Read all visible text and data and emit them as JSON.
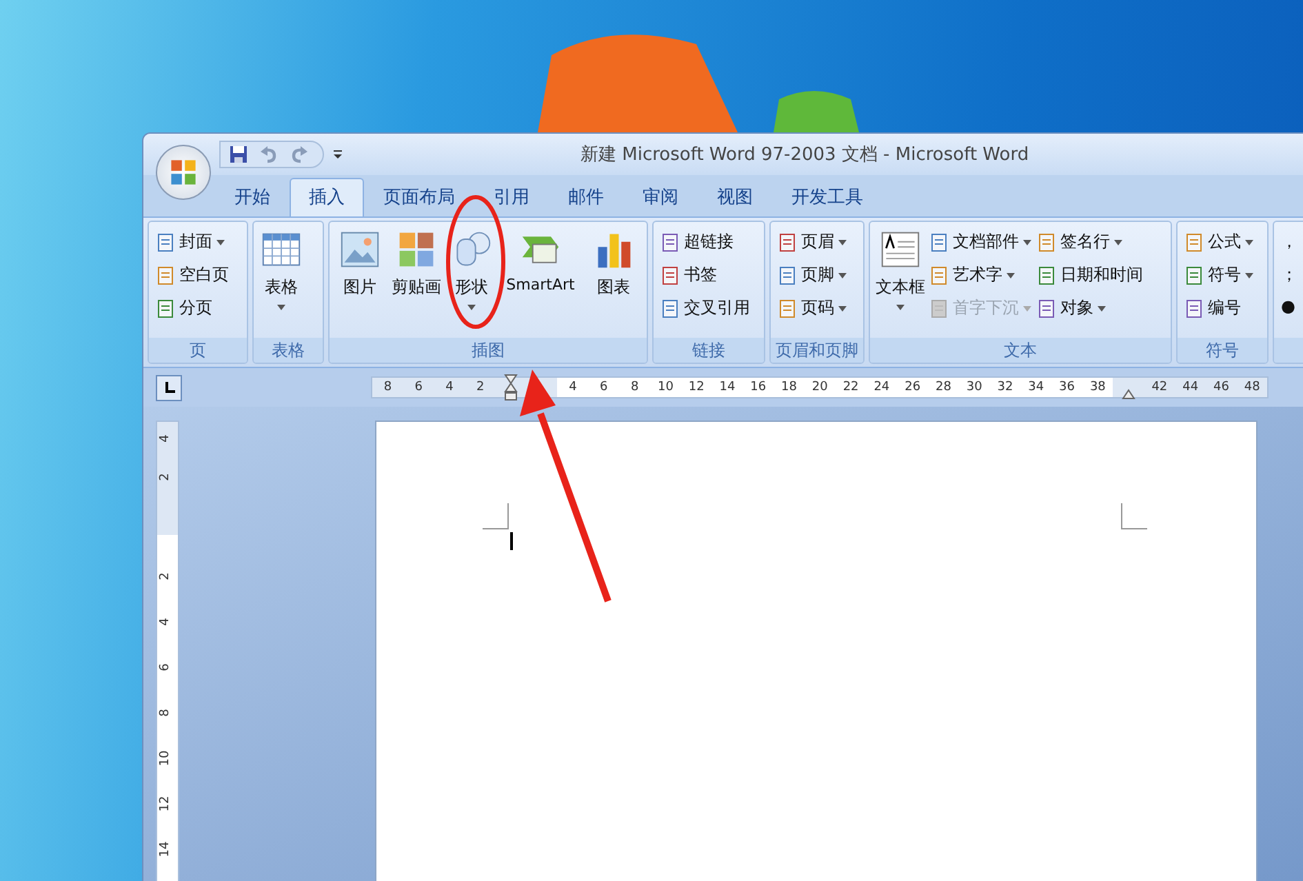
{
  "window": {
    "title": "新建 Microsoft Word 97-2003 文档 - Microsoft Word"
  },
  "tabs": [
    {
      "label": "开始",
      "selected": false
    },
    {
      "label": "插入",
      "selected": true
    },
    {
      "label": "页面布局",
      "selected": false
    },
    {
      "label": "引用",
      "selected": false
    },
    {
      "label": "邮件",
      "selected": false
    },
    {
      "label": "审阅",
      "selected": false
    },
    {
      "label": "视图",
      "selected": false
    },
    {
      "label": "开发工具",
      "selected": false
    }
  ],
  "ribbon_groups": [
    {
      "label": "页",
      "columns": [
        [
          {
            "label": "封面",
            "dropdown": true,
            "disabled": false
          },
          {
            "label": "空白页",
            "dropdown": false,
            "disabled": false
          },
          {
            "label": "分页",
            "dropdown": false,
            "disabled": false
          }
        ]
      ]
    },
    {
      "label": "表格",
      "large": [
        {
          "label": "表格",
          "dropdown": true
        }
      ]
    },
    {
      "label": "插图",
      "large": [
        {
          "label": "图片",
          "dropdown": false
        },
        {
          "label": "剪贴画",
          "dropdown": false
        },
        {
          "label": "形状",
          "dropdown": true
        },
        {
          "label": "SmartArt",
          "dropdown": false
        },
        {
          "label": "图表",
          "dropdown": false
        }
      ]
    },
    {
      "label": "链接",
      "columns": [
        [
          {
            "label": "超链接",
            "dropdown": false,
            "disabled": false
          },
          {
            "label": "书签",
            "dropdown": false,
            "disabled": false
          },
          {
            "label": "交叉引用",
            "dropdown": false,
            "disabled": false
          }
        ]
      ]
    },
    {
      "label": "页眉和页脚",
      "columns": [
        [
          {
            "label": "页眉",
            "dropdown": true,
            "disabled": false
          },
          {
            "label": "页脚",
            "dropdown": true,
            "disabled": false
          },
          {
            "label": "页码",
            "dropdown": true,
            "disabled": false
          }
        ]
      ]
    },
    {
      "label": "文本",
      "large": [
        {
          "label": "文本框",
          "dropdown": true
        }
      ],
      "columns": [
        [
          {
            "label": "文档部件",
            "dropdown": true,
            "disabled": false
          },
          {
            "label": "艺术字",
            "dropdown": true,
            "disabled": false
          },
          {
            "label": "首字下沉",
            "dropdown": true,
            "disabled": true
          }
        ],
        [
          {
            "label": "签名行",
            "dropdown": true,
            "disabled": false
          },
          {
            "label": "日期和时间",
            "dropdown": false,
            "disabled": false
          },
          {
            "label": "对象",
            "dropdown": true,
            "disabled": false
          }
        ]
      ]
    },
    {
      "label": "符号",
      "columns": [
        [
          {
            "label": "公式",
            "dropdown": true,
            "disabled": false
          },
          {
            "label": "符号",
            "dropdown": true,
            "disabled": false
          },
          {
            "label": "编号",
            "dropdown": false,
            "disabled": false
          }
        ]
      ]
    },
    {
      "columns": [
        [
          {
            "label": "，",
            "dropdown": false,
            "disabled": false
          },
          {
            "label": "；",
            "dropdown": false,
            "disabled": false
          },
          {
            "label": "●",
            "dropdown": false,
            "disabled": false
          }
        ]
      ]
    }
  ],
  "horizontal_ruler": {
    "left_labels": [
      "8",
      "6",
      "4",
      "2"
    ],
    "middle_labels": [
      "4",
      "6",
      "8",
      "10",
      "12",
      "14",
      "16",
      "18",
      "20",
      "22",
      "24",
      "26",
      "28",
      "30",
      "32",
      "34",
      "36",
      "38"
    ],
    "right_labels": [
      "42",
      "44",
      "46",
      "48"
    ]
  },
  "vertical_ruler": {
    "top_labels": [
      "4",
      "2"
    ],
    "body_labels": [
      "2",
      "4",
      "6",
      "8",
      "10",
      "12",
      "14"
    ]
  }
}
